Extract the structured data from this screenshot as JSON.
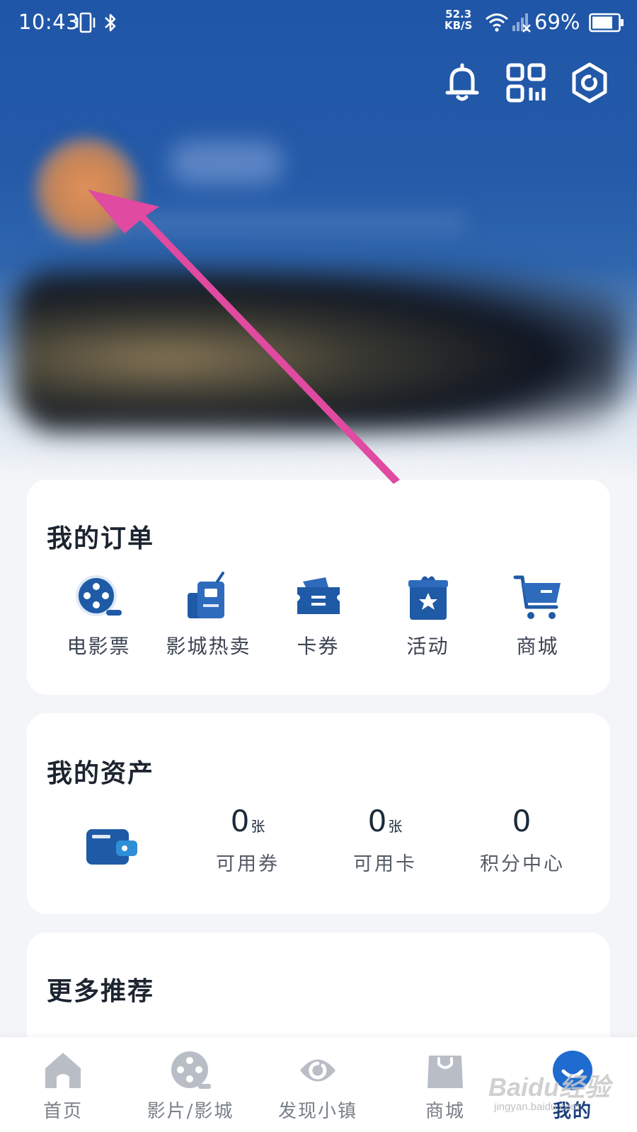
{
  "status_bar": {
    "time": "10:43",
    "net_speed_value": "52.3",
    "net_speed_unit": "KB/S",
    "battery": "69%"
  },
  "header": {
    "icons": [
      "bell-icon",
      "qr-code-icon",
      "settings-icon"
    ]
  },
  "orders": {
    "title": "我的订单",
    "items": [
      {
        "label": "电影票",
        "icon": "movie-ticket-icon"
      },
      {
        "label": "影城热卖",
        "icon": "cinema-hot-sale-icon"
      },
      {
        "label": "卡券",
        "icon": "coupon-icon"
      },
      {
        "label": "活动",
        "icon": "activity-icon"
      },
      {
        "label": "商城",
        "icon": "shop-cart-icon"
      }
    ]
  },
  "assets": {
    "title": "我的资产",
    "items": [
      {
        "value": "0",
        "unit": "张",
        "label": "可用券"
      },
      {
        "value": "0",
        "unit": "张",
        "label": "可用卡"
      },
      {
        "value": "0",
        "unit": "",
        "label": "积分中心"
      }
    ]
  },
  "recommend": {
    "title": "更多推荐"
  },
  "bottom_nav": {
    "items": [
      {
        "label": "首页",
        "icon": "home-icon"
      },
      {
        "label": "影片/影城",
        "icon": "film-reel-icon"
      },
      {
        "label": "发现小镇",
        "icon": "discover-icon"
      },
      {
        "label": "商城",
        "icon": "shopping-bag-icon"
      },
      {
        "label": "我的",
        "icon": "profile-icon",
        "active": true
      }
    ]
  },
  "watermark": {
    "brand": "Baidu经验",
    "url": "jingyan.baidu.com"
  },
  "colors": {
    "primary": "#1f5aa6",
    "annotation_arrow": "#e04aa0",
    "card_bg": "#ffffff",
    "page_bg": "#f4f5f8"
  }
}
